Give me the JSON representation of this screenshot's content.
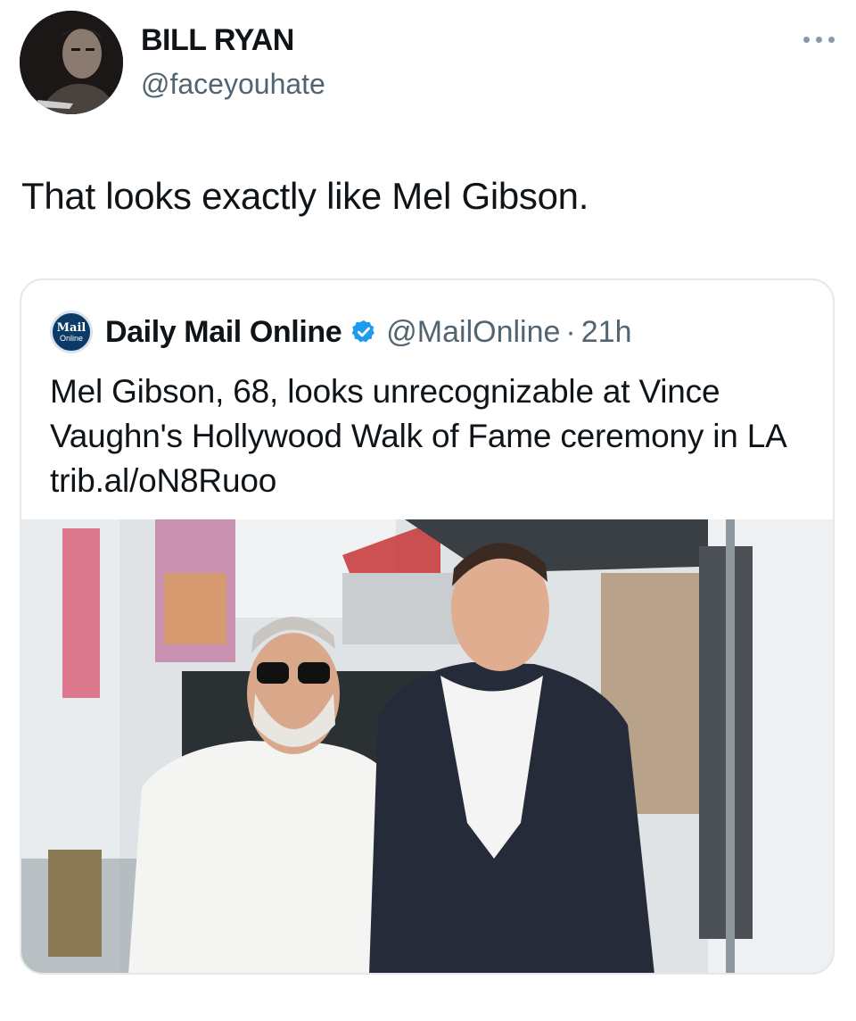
{
  "tweet": {
    "author_name": "BILL RYAN",
    "author_handle": "@faceyouhate",
    "avatar_icon": "profile-avatar",
    "more_icon": "more-options-icon",
    "text": "That looks exactly like Mel Gibson."
  },
  "quoted": {
    "logo_line1": "Mail",
    "logo_line2": "Online",
    "author_name": "Daily Mail Online",
    "verified_icon": "verified-badge-icon",
    "author_handle": "@MailOnline",
    "separator": "·",
    "time": "21h",
    "text": "Mel Gibson, 68, looks unrecognizable at Vince Vaughn's Hollywood Walk of Fame ceremony in LA trib.al/oN8Ruoo"
  },
  "colors": {
    "accent_verified": "#1d9bf0",
    "secondary_text": "#536471",
    "mail_logo": "#0a3a66"
  }
}
